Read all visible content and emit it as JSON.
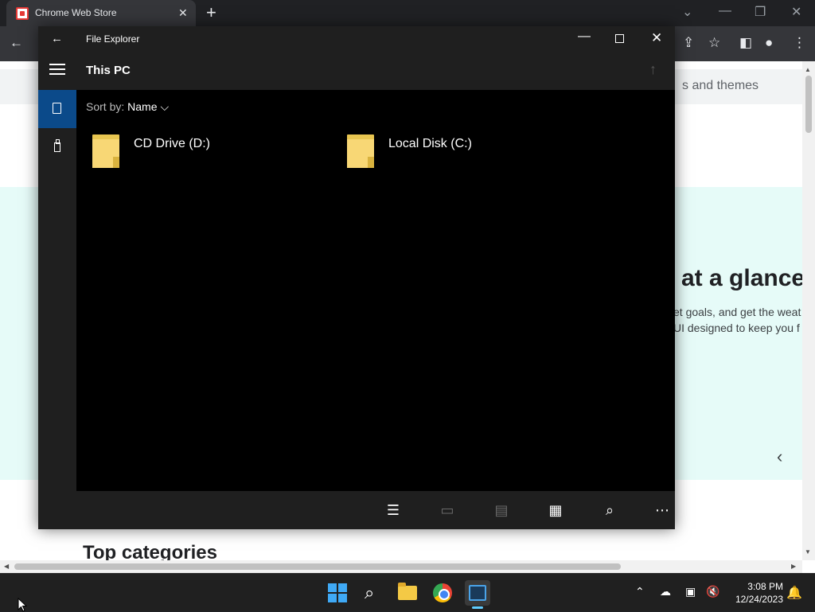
{
  "chrome": {
    "tab_title": "Chrome Web Store",
    "tab_close": "✕",
    "new_tab": "+",
    "back": "←",
    "page": {
      "strip_text": "s and themes",
      "hero_title": "at a glance",
      "hero_line1": "et goals, and get the weat",
      "hero_line2": "UI designed to keep you f",
      "hero_chevron": "‹",
      "section_title": "Top categories"
    }
  },
  "file_explorer": {
    "app_title": "File Explorer",
    "location": "This PC",
    "sort_label": "Sort by:",
    "sort_value": "Name",
    "drives": [
      {
        "label": "CD Drive (D:)"
      },
      {
        "label": "Local Disk (C:)"
      }
    ],
    "colors": {
      "accent": "#0b4a8a",
      "folder": "#f8d775"
    }
  },
  "taskbar": {
    "clock_time": "3:08 PM",
    "clock_date": "12/24/2023",
    "colors": {
      "accent": "#60cdff"
    }
  }
}
